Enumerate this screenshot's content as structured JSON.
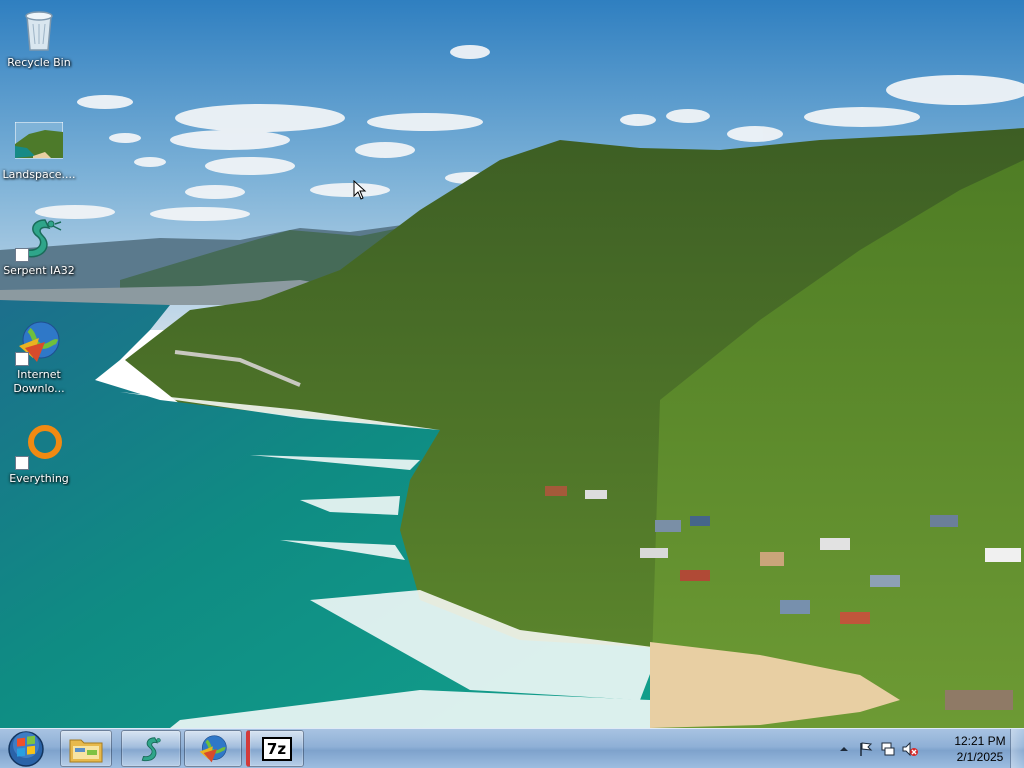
{
  "desktop": {
    "icons": [
      {
        "label": "Recycle Bin",
        "icon": "recycle-bin-icon"
      },
      {
        "label": "Landspace....",
        "icon": "image-file-icon"
      },
      {
        "label": "Serpent IA32",
        "icon": "serpent-icon"
      },
      {
        "label": "Internet Downlo...",
        "icon": "internet-download-manager-icon"
      },
      {
        "label": "Everything",
        "icon": "everything-search-icon"
      }
    ]
  },
  "taskbar": {
    "start_icon": "windows-start-icon",
    "pinned": [
      {
        "app": "File Explorer",
        "icon": "folder-icon"
      },
      {
        "app": "Serpent IA32",
        "icon": "serpent-icon"
      },
      {
        "app": "Internet Download Manager",
        "icon": "internet-download-manager-icon"
      },
      {
        "app": "7-Zip",
        "icon": "7zip-icon",
        "glyph": "7z"
      }
    ],
    "tray": {
      "icons": [
        "show-hidden-icons-icon",
        "action-center-flag-icon",
        "network-icon",
        "volume-muted-icon"
      ],
      "time": "12:21 PM",
      "date": "2/1/2025"
    }
  },
  "colors": {
    "taskbar": "#8fb0d6",
    "label_text": "#ffffff",
    "ocean": "#0e7f84",
    "hills": "#3f6a22"
  }
}
